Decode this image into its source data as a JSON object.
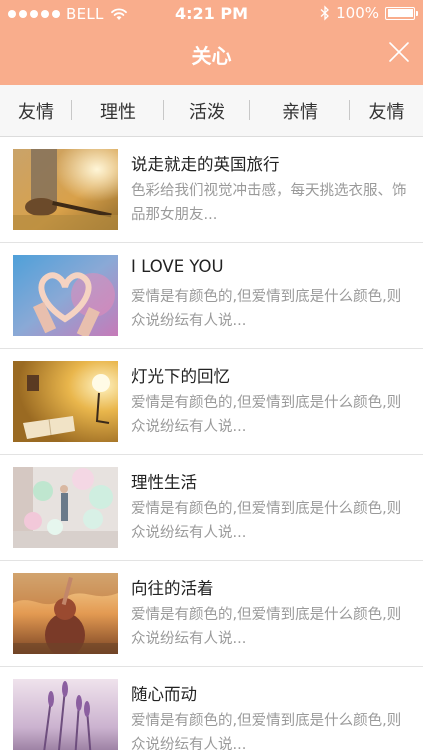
{
  "status_bar": {
    "carrier": "BELL",
    "time": "4:21 PM",
    "battery": "100%",
    "signal_bars_filled": 5,
    "battery_level": 1.0
  },
  "nav": {
    "title": "关心",
    "close_icon": "close-icon"
  },
  "tabs": [
    "友情",
    "理性",
    "活泼",
    "亲情",
    "友情"
  ],
  "articles": [
    {
      "title": "说走就走的英国旅行",
      "desc": "色彩给我们视觉冲击感，每天挑选衣服、饰品那女朋友..."
    },
    {
      "title": "I LOVE YOU",
      "desc": "爱情是有颜色的,但爱情到底是什么颜色,则众说纷纭有人说..."
    },
    {
      "title": "灯光下的回忆",
      "desc": "爱情是有颜色的,但爱情到底是什么颜色,则众说纷纭有人说..."
    },
    {
      "title": "理性生活",
      "desc": "爱情是有颜色的,但爱情到底是什么颜色,则众说纷纭有人说..."
    },
    {
      "title": "向往的活着",
      "desc": "爱情是有颜色的,但爱情到底是什么颜色,则众说纷纭有人说..."
    },
    {
      "title": "随心而动",
      "desc": "爱情是有颜色的,但爱情到底是什么颜色,则众说纷纭有人说..."
    }
  ],
  "colors": {
    "header_bg": "#f9ad8c",
    "tab_bg": "#f7f7f7",
    "title_text": "#222222",
    "desc_text": "#9a9a9a"
  }
}
